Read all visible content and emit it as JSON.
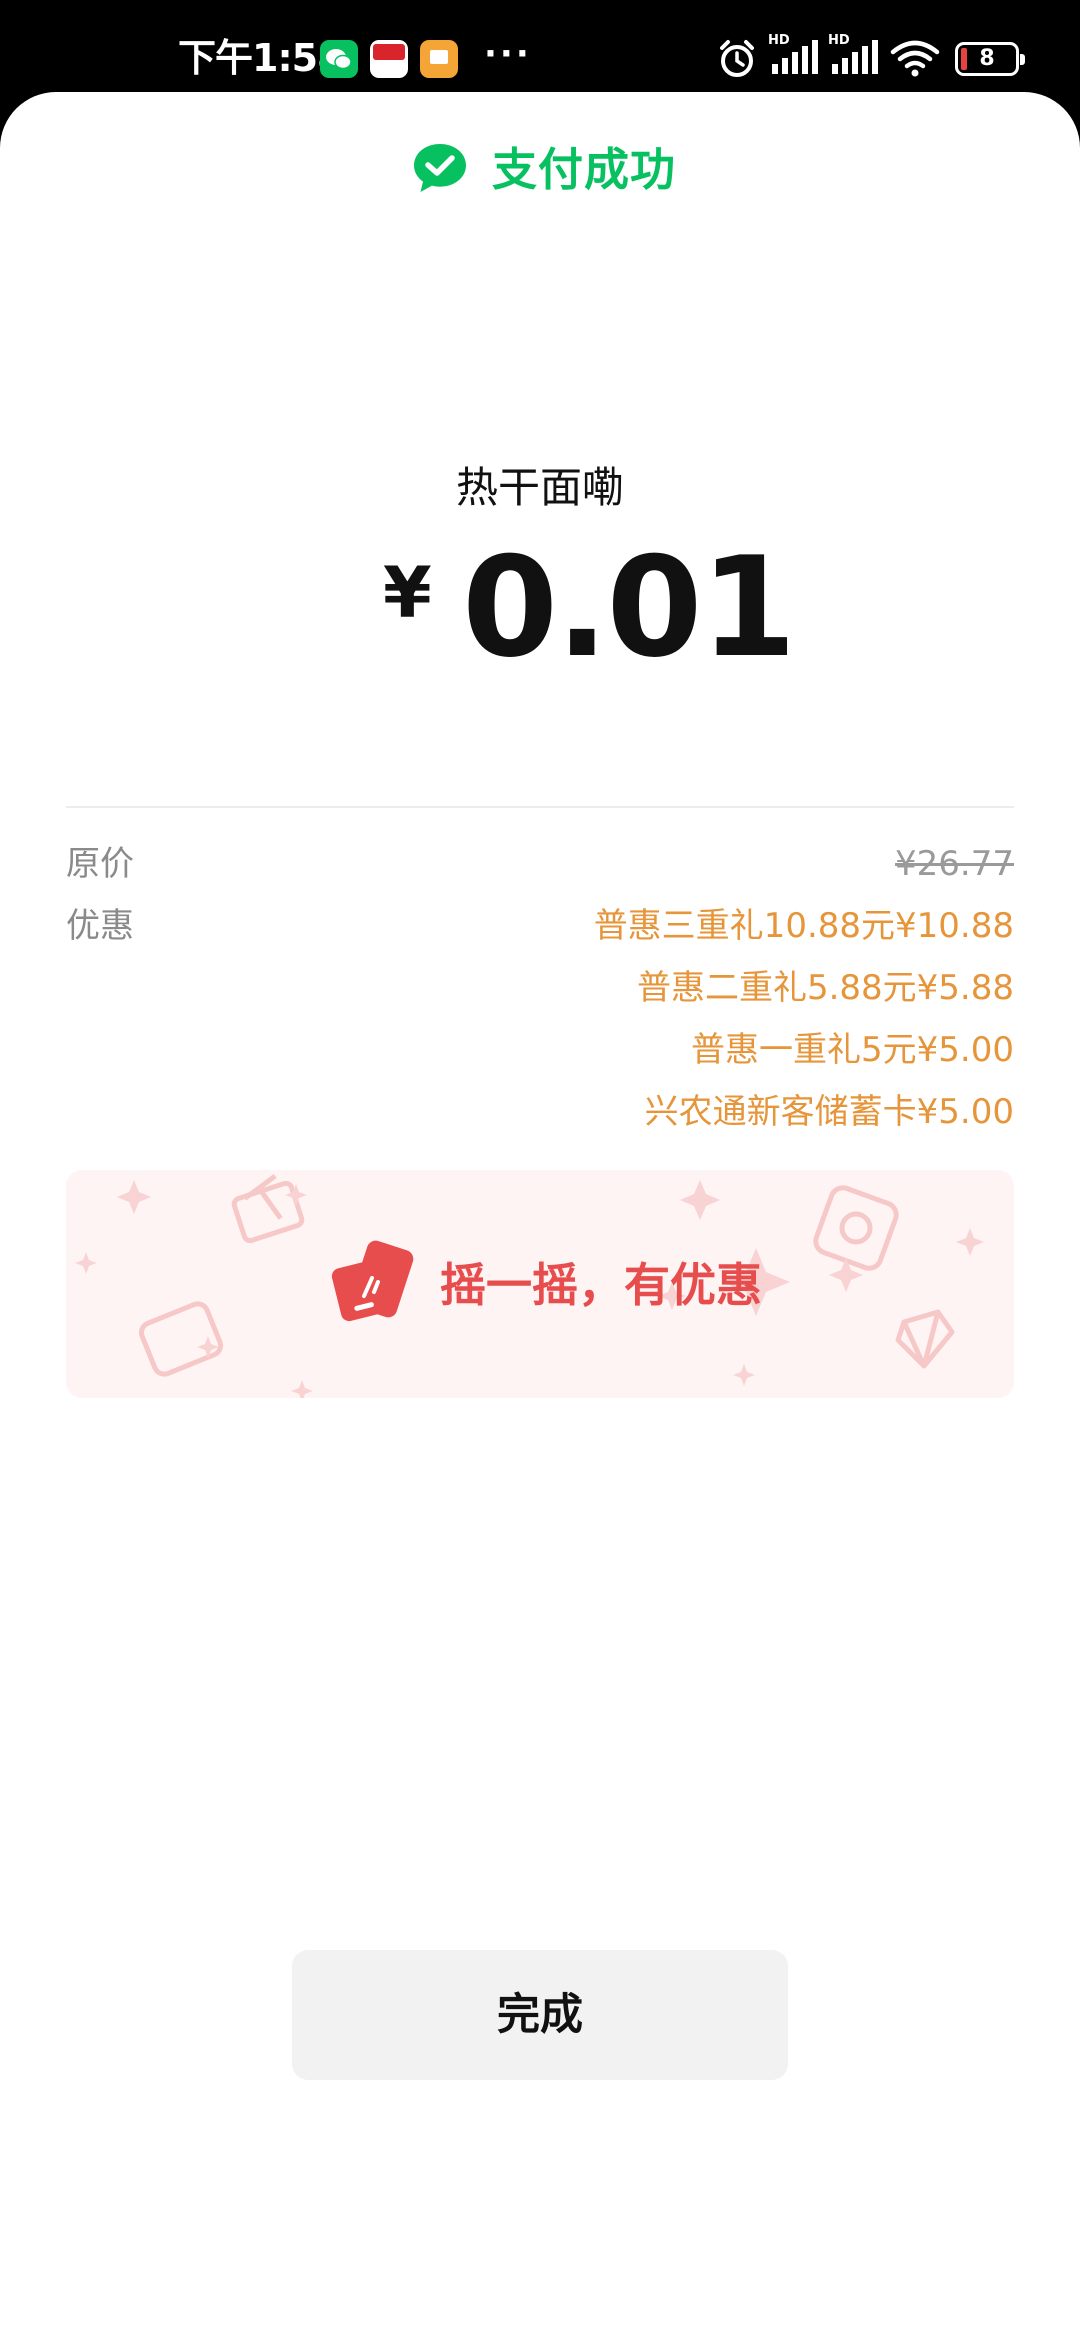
{
  "status_bar": {
    "time": "下午1:58",
    "battery": "8",
    "app_icons": [
      "wechat-icon",
      "pay-app-icon",
      "notes-icon"
    ],
    "more": "···"
  },
  "header": {
    "title": "支付成功",
    "brand_color": "#07c160"
  },
  "payment": {
    "merchant": "热干面嘞",
    "currency": "¥",
    "amount": "0.01"
  },
  "details": {
    "original_label": "原价",
    "original_price": "¥26.77",
    "discount_label": "优惠",
    "discounts": [
      "普惠三重礼10.88元¥10.88",
      "普惠二重礼5.88元¥5.88",
      "普惠一重礼5元¥5.00",
      "兴农通新客储蓄卡¥5.00"
    ],
    "discount_color": "#e6953a"
  },
  "shake_banner": {
    "text": "摇一摇，有优惠",
    "color": "#e74d4d"
  },
  "done_button": {
    "label": "完成"
  }
}
